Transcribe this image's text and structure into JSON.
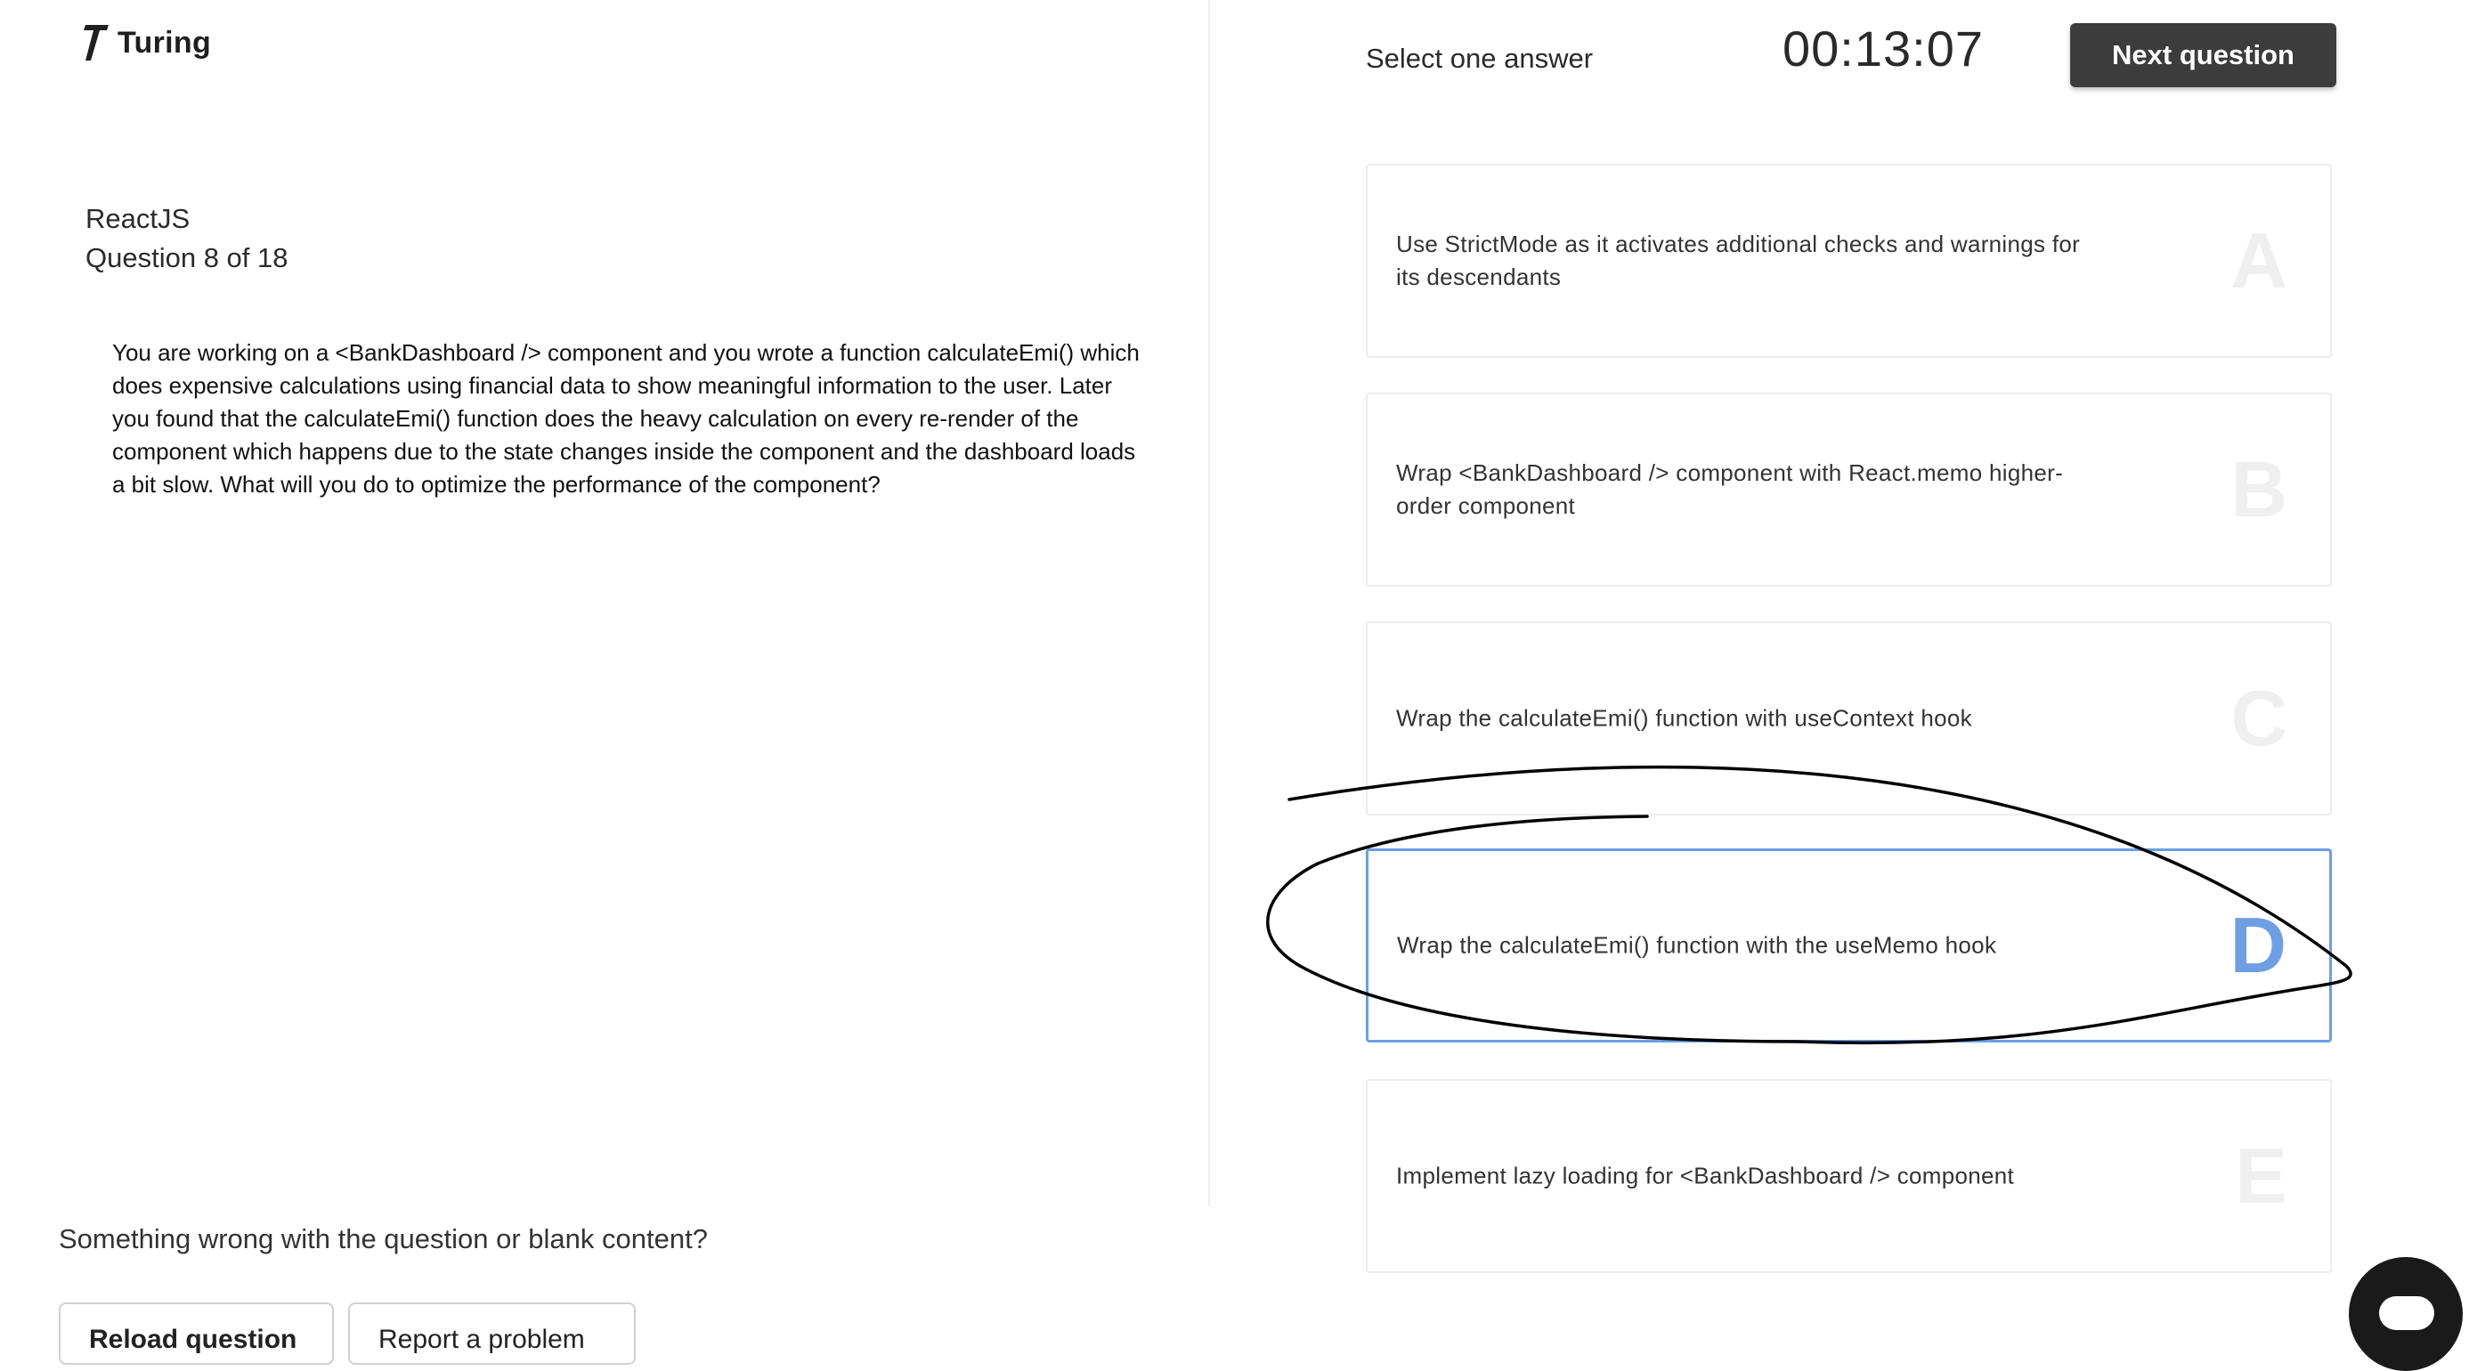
{
  "brand": {
    "name": "Turing"
  },
  "question": {
    "subject": "ReactJS",
    "number_label": "Question 8 of 18",
    "text": "You are working on a <BankDashboard /> component and you wrote a function calculateEmi() which does expensive calculations using financial data to show meaningful information to the user. Later you found that the calculateEmi() function does the heavy calculation on every re-render of the component which happens due to the state changes inside the component and the dashboard loads a bit slow. What will you do to optimize the performance of the component?"
  },
  "footer": {
    "problem_prompt": "Something wrong with the question or blank content?",
    "reload_label": "Reload question",
    "report_label": "Report a problem"
  },
  "header": {
    "instruction": "Select one answer",
    "timer": "00:13:07",
    "next_label": "Next question"
  },
  "options": [
    {
      "letter": "A",
      "text": "Use StrictMode as it activates additional checks and warnings for its descendants",
      "selected": false
    },
    {
      "letter": "B",
      "text": "Wrap <BankDashboard /> component with React.memo higher-order component",
      "selected": false
    },
    {
      "letter": "C",
      "text": "Wrap the calculateEmi() function with useContext hook",
      "selected": false
    },
    {
      "letter": "D",
      "text": "Wrap the calculateEmi() function with the useMemo hook",
      "selected": true
    },
    {
      "letter": "E",
      "text": "Implement lazy loading for <BankDashboard /> component",
      "selected": false
    }
  ],
  "colors": {
    "selected_border": "#6a9fe4",
    "next_button_bg": "#3c3c3c",
    "chat_button_bg": "#1a1a1a"
  }
}
